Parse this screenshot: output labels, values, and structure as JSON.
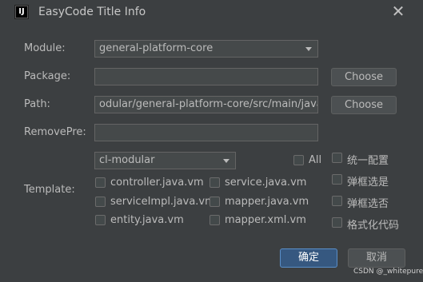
{
  "window": {
    "title": "EasyCode Title Info",
    "app_icon": "IJ"
  },
  "form": {
    "module_label": "Module:",
    "module_value": "general-platform-core",
    "package_label": "Package:",
    "package_value": "",
    "path_label": "Path:",
    "path_value": "odular/general-platform-core/src/main/java",
    "removepre_label": "RemovePre:",
    "removepre_value": "",
    "choose_label": "Choose",
    "template_label": "Template:",
    "group_value": "cl-modular",
    "all_label": "All"
  },
  "templates": [
    {
      "label": "controller.java.vm",
      "checked": false
    },
    {
      "label": "service.java.vm",
      "checked": false
    },
    {
      "label": "serviceImpl.java.vm",
      "checked": false
    },
    {
      "label": "mapper.java.vm",
      "checked": false
    },
    {
      "label": "entity.java.vm",
      "checked": false
    },
    {
      "label": "mapper.xml.vm",
      "checked": false
    }
  ],
  "options": [
    "统一配置",
    "弹框选是",
    "弹框选否",
    "格式化代码"
  ],
  "footer": {
    "ok_label": "确定",
    "cancel_label": "取消",
    "watermark": "CSDN @_whitepure"
  }
}
